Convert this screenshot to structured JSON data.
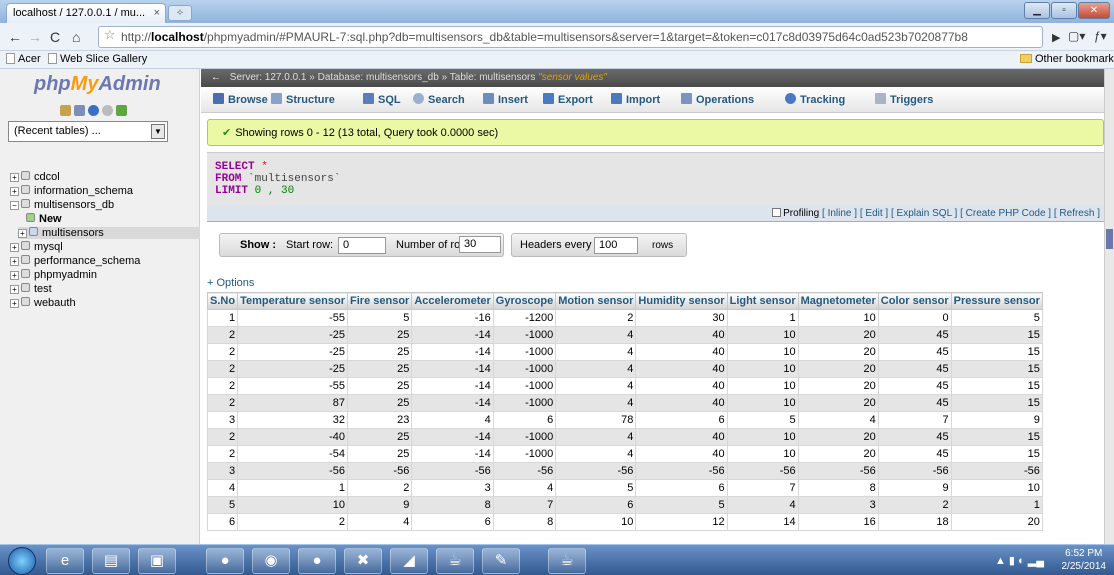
{
  "browser": {
    "tab_title": "localhost / 127.0.0.1 / mu...",
    "tab_close": "×",
    "url_prefix": "http://",
    "url_host": "localhost",
    "url_rest": "/phpmyadmin/#PMAURL-7:sql.php?db=multisensors_db&table=multisensors&server=1&target=&token=c017c8d03975d64c0ad523b7020877b8",
    "bookmarks": [
      "Acer",
      "Web Slice Gallery"
    ],
    "other_bookmarks": "Other bookmarks"
  },
  "logo": {
    "php": "php",
    "my": "My",
    "admin": "Admin"
  },
  "nav": {
    "recent_tables": "(Recent tables) ...",
    "tree": [
      {
        "label": "cdcol"
      },
      {
        "label": "information_schema"
      },
      {
        "label": "multisensors_db"
      },
      {
        "label": "New"
      },
      {
        "label": "multisensors"
      },
      {
        "label": "mysql"
      },
      {
        "label": "performance_schema"
      },
      {
        "label": "phpmyadmin"
      },
      {
        "label": "test"
      },
      {
        "label": "webauth"
      }
    ]
  },
  "breadcrumb": {
    "server": "Server: 127.0.0.1 »",
    "database": "Database: multisensors_db »",
    "table": "Table: multisensors",
    "table_comment": "\"sensor values\""
  },
  "menu": {
    "tabs": [
      "Browse",
      "Structure",
      "SQL",
      "Search",
      "Insert",
      "Export",
      "Import",
      "Operations",
      "Tracking",
      "Triggers"
    ]
  },
  "message": "Showing rows 0 - 12 (13 total, Query took 0.0000 sec)",
  "sql": {
    "select": "SELECT",
    "star": "*",
    "from": "FROM",
    "table": "`multisensors`",
    "limit": "LIMIT",
    "limit_vals": "0 , 30"
  },
  "sql_links": {
    "profiling": "Profiling",
    "inline": "[ Inline ]",
    "edit": "[ Edit ]",
    "explain": "[ Explain SQL ]",
    "php": "[ Create PHP Code ]",
    "refresh": "[ Refresh ]"
  },
  "show_bar": {
    "show_label": "Show :",
    "start_row_label": "Start row:",
    "start_row": "0",
    "num_rows_label": "Number of rows:",
    "num_rows": "30",
    "headers_label": "Headers every",
    "headers_every": "100",
    "rows_label": "rows"
  },
  "options_label": "+ Options",
  "table": {
    "columns": [
      "S.No",
      "Temperature sensor",
      "Fire sensor",
      "Accelerometer",
      "Gyroscope",
      "Motion sensor",
      "Humidity sensor",
      "Light sensor",
      "Magnetometer",
      "Color sensor",
      "Pressure sensor"
    ],
    "rows": [
      [
        "1",
        "-55",
        "5",
        "-16",
        "-1200",
        "2",
        "30",
        "1",
        "10",
        "0",
        "5"
      ],
      [
        "2",
        "-25",
        "25",
        "-14",
        "-1000",
        "4",
        "40",
        "10",
        "20",
        "45",
        "15"
      ],
      [
        "2",
        "-25",
        "25",
        "-14",
        "-1000",
        "4",
        "40",
        "10",
        "20",
        "45",
        "15"
      ],
      [
        "2",
        "-25",
        "25",
        "-14",
        "-1000",
        "4",
        "40",
        "10",
        "20",
        "45",
        "15"
      ],
      [
        "2",
        "-55",
        "25",
        "-14",
        "-1000",
        "4",
        "40",
        "10",
        "20",
        "45",
        "15"
      ],
      [
        "2",
        "87",
        "25",
        "-14",
        "-1000",
        "4",
        "40",
        "10",
        "20",
        "45",
        "15"
      ],
      [
        "3",
        "32",
        "23",
        "4",
        "6",
        "78",
        "6",
        "5",
        "4",
        "7",
        "9"
      ],
      [
        "2",
        "-40",
        "25",
        "-14",
        "-1000",
        "4",
        "40",
        "10",
        "20",
        "45",
        "15"
      ],
      [
        "2",
        "-54",
        "25",
        "-14",
        "-1000",
        "4",
        "40",
        "10",
        "20",
        "45",
        "15"
      ],
      [
        "3",
        "-56",
        "-56",
        "-56",
        "-56",
        "-56",
        "-56",
        "-56",
        "-56",
        "-56",
        "-56"
      ],
      [
        "4",
        "1",
        "2",
        "3",
        "4",
        "5",
        "6",
        "7",
        "8",
        "9",
        "10"
      ],
      [
        "5",
        "10",
        "9",
        "8",
        "7",
        "6",
        "5",
        "4",
        "3",
        "2",
        "1"
      ],
      [
        "6",
        "2",
        "4",
        "6",
        "8",
        "10",
        "12",
        "14",
        "16",
        "18",
        "20"
      ]
    ]
  },
  "taskbar": {
    "clock_time": "6:52 PM",
    "clock_date": "2/25/2014"
  }
}
